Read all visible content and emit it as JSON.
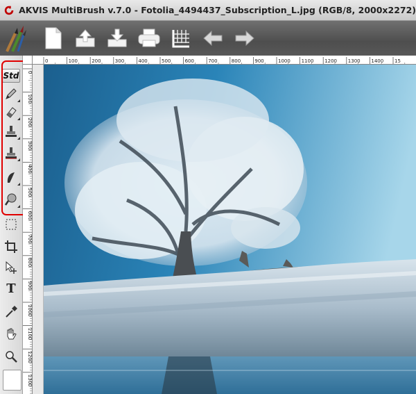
{
  "window": {
    "title": "AKVIS MultiBrush v.7.0 - Fotolia_4494437_Subscription_L.jpg (RGB/8, 2000x2272)"
  },
  "toolbar": {
    "buttons": [
      "new-document",
      "open",
      "save",
      "print",
      "grid",
      "undo",
      "redo"
    ]
  },
  "tools": {
    "std_label": "Std",
    "items": [
      "pencil-brush-icon",
      "eraser-icon",
      "clone-stamp-icon",
      "pattern-stamp-icon",
      "smudge-icon",
      "blur-icon",
      "selection-icon",
      "crop-icon",
      "move-icon",
      "text-icon",
      "eyedropper-icon",
      "hand-icon",
      "zoom-icon"
    ],
    "text_tool_label": "T"
  },
  "ruler": {
    "top_labels": [
      "0",
      "100",
      "200",
      "300",
      "400",
      "500",
      "600",
      "700",
      "800",
      "900",
      "1000",
      "1100",
      "1200",
      "1300",
      "1400",
      "15"
    ],
    "left_labels": [
      "0",
      "100",
      "200",
      "300",
      "400",
      "500",
      "600",
      "700",
      "800",
      "900",
      "1000",
      "1100",
      "1200",
      "1300"
    ]
  },
  "colors": {
    "highlight": "#e00000",
    "sky_top": "#1f6f9e",
    "sky_right": "#9fd0e6",
    "ground": "#c8d8e4"
  }
}
